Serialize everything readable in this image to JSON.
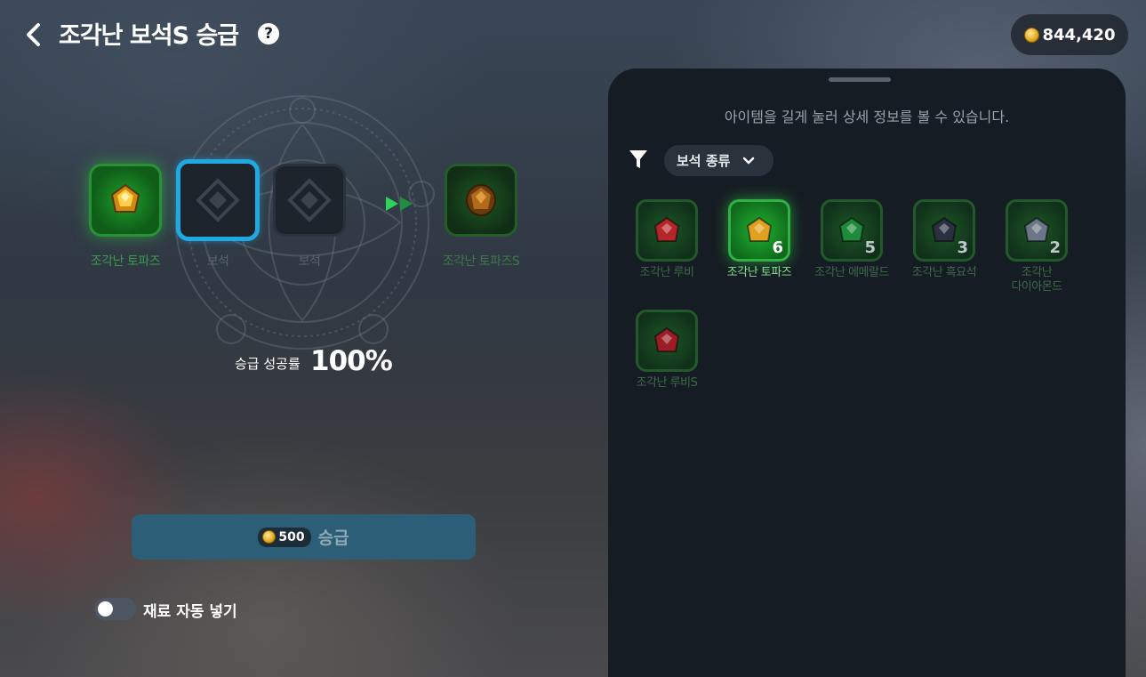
{
  "header": {
    "title": "조각난 보석S 승급",
    "currency": "844,420"
  },
  "upgrade": {
    "slots": [
      {
        "label": "조각난 토파즈",
        "state": "filled",
        "gem": "topaz"
      },
      {
        "label": "보석",
        "state": "empty-selected"
      },
      {
        "label": "보석",
        "state": "empty"
      }
    ],
    "result_label": "조각난 토파즈S",
    "success_rate_label": "승급 성공률",
    "success_rate_value": "100%",
    "cost": "500",
    "button_label": "승급"
  },
  "auto_fill": {
    "label": "재료 자동 넣기",
    "enabled": false
  },
  "inventory": {
    "hint": "아이템을 길게 눌러 상세 정보를 볼 수 있습니다.",
    "filter_label": "보석 종류",
    "items": [
      {
        "name": "조각난 루비",
        "count": "",
        "gem": "ruby",
        "color": "#b5262b",
        "selected": false
      },
      {
        "name": "조각난 토파즈",
        "count": "6",
        "gem": "topaz",
        "color": "#e0a020",
        "selected": true
      },
      {
        "name": "조각난 에메랄드",
        "count": "5",
        "gem": "emerald",
        "color": "#1f8b3a",
        "selected": false
      },
      {
        "name": "조각난 흑요석",
        "count": "3",
        "gem": "obsidian",
        "color": "#2a3040",
        "selected": false
      },
      {
        "name": "조각난\n다이아몬드",
        "count": "2",
        "gem": "diamond",
        "color": "#6b7688",
        "selected": false
      },
      {
        "name": "조각난 루비S",
        "count": "",
        "gem": "ruby-s",
        "color": "#9c1d25",
        "selected": false
      }
    ]
  },
  "colors": {
    "accent_blue": "#20a9e0",
    "accent_green": "#32b043",
    "panel_bg": "#161c23"
  }
}
